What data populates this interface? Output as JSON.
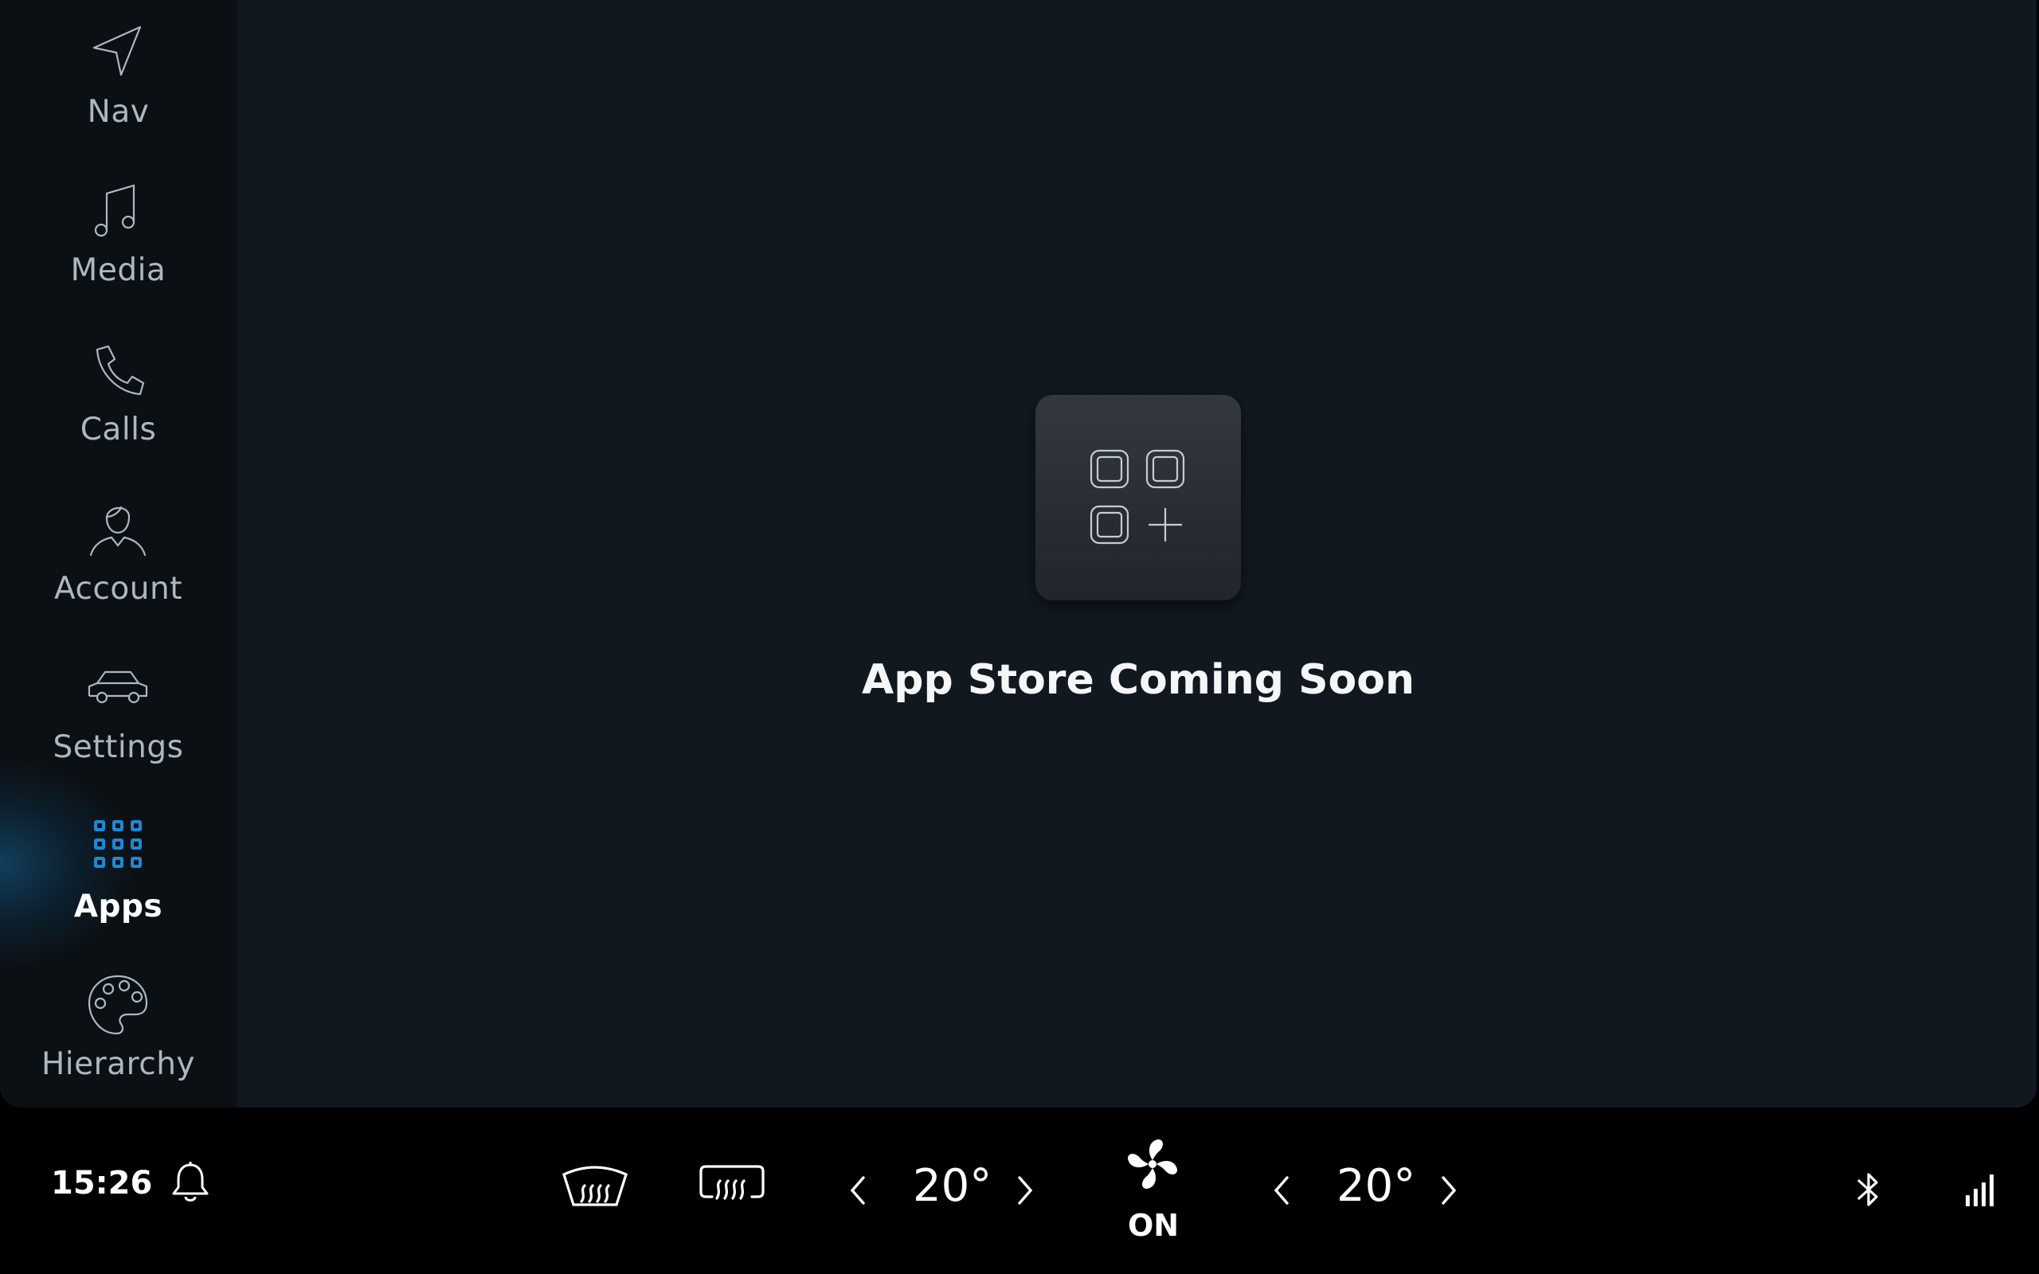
{
  "sidebar": {
    "items": [
      {
        "label": "Nav",
        "icon": "navigation-arrow-icon"
      },
      {
        "label": "Media",
        "icon": "music-note-icon"
      },
      {
        "label": "Calls",
        "icon": "phone-icon"
      },
      {
        "label": "Account",
        "icon": "person-icon"
      },
      {
        "label": "Settings",
        "icon": "car-icon"
      },
      {
        "label": "Apps",
        "icon": "apps-grid-icon",
        "active": true
      },
      {
        "label": "Hierarchy",
        "icon": "palette-icon"
      }
    ]
  },
  "main": {
    "icon": "app-store-icon",
    "message": "App Store Coming Soon"
  },
  "bottom_bar": {
    "time": "15:26",
    "left_temp": "20°",
    "right_temp": "20°",
    "fan_status": "ON"
  },
  "colors": {
    "accent": "#1e88d4",
    "panel": "#111820",
    "rail": "#0b1015",
    "bar": "#000000"
  }
}
